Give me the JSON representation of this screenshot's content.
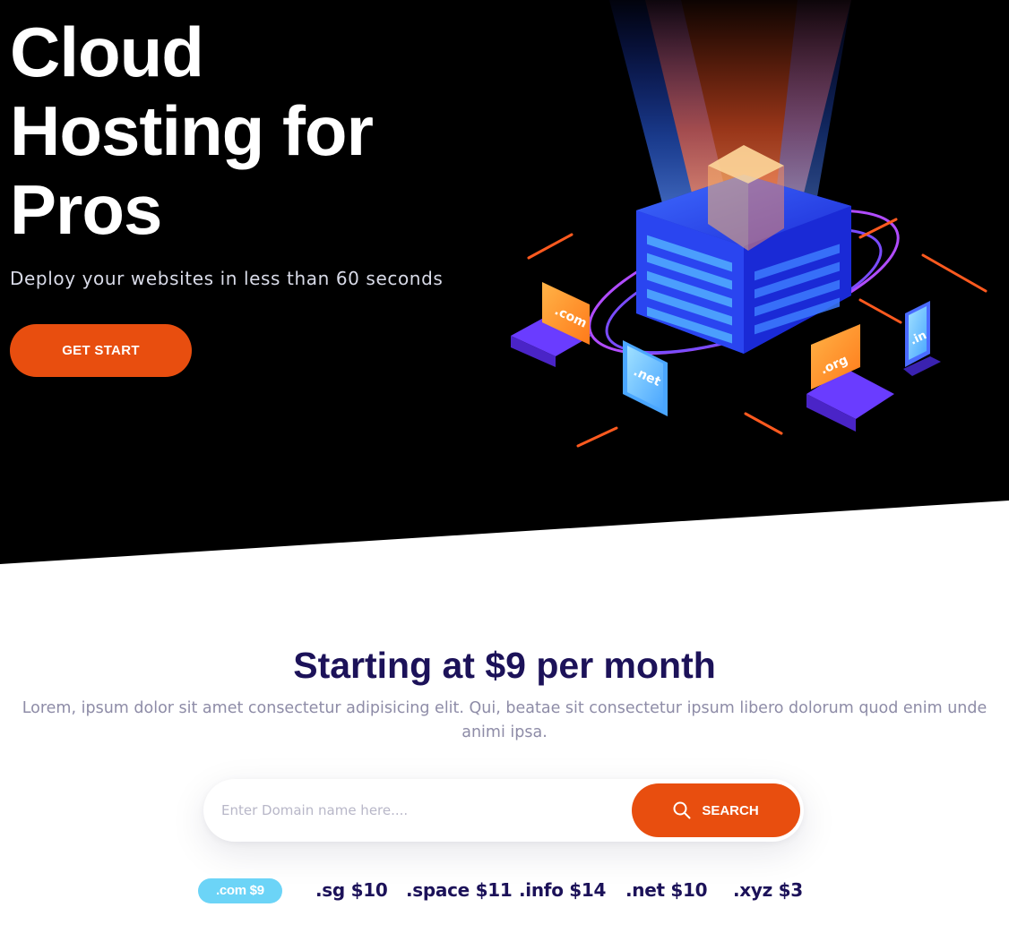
{
  "hero": {
    "title_line1": "Cloud",
    "title_line2": "Hosting for",
    "title_line3": "Pros",
    "subtitle": "Deploy your websites in less than 60 seconds",
    "cta_label": "GET START",
    "illustration_labels": [
      ".com",
      ".net",
      ".org",
      ".in"
    ]
  },
  "pricing": {
    "title": "Starting at $9 per month",
    "description": "Lorem, ipsum dolor sit amet consectetur adipisicing elit. Qui, beatae sit consectetur ipsum libero dolorum quod enim unde animi ipsa."
  },
  "search": {
    "placeholder": "Enter Domain name here....",
    "button_label": "SEARCH",
    "button_icon": "search-icon"
  },
  "tlds": [
    {
      "label": ".com $9",
      "active": true
    },
    {
      "label": ".sg $10",
      "active": false
    },
    {
      "label": ".space $11",
      "active": false
    },
    {
      "label": ".info $14",
      "active": false
    },
    {
      "label": ".net $10",
      "active": false
    },
    {
      "label": ".xyz $3",
      "active": false
    }
  ],
  "colors": {
    "accent": "#e84e0f",
    "heading": "#1c1259",
    "active_tld": "#6cd4f7",
    "hero_bg": "#000000"
  }
}
